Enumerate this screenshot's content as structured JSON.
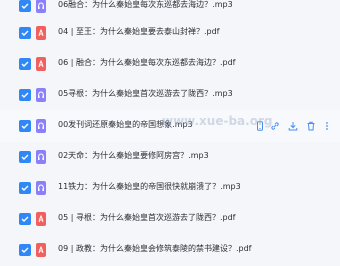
{
  "files": [
    {
      "name": "06融合：为什么秦始皇每次东巡都去海边？.mp3",
      "type": "mp3",
      "checked": true
    },
    {
      "name": "04 | 至王：为什么秦始皇要去泰山封禅？.pdf",
      "type": "pdf",
      "checked": true
    },
    {
      "name": "06 | 融合：为什么秦始皇每次东巡都去海边？.pdf",
      "type": "pdf",
      "checked": true
    },
    {
      "name": "05寻根：为什么秦始皇首次巡游去了陇西？.mp3",
      "type": "mp3",
      "checked": true
    },
    {
      "name": "00发刊词还原秦始皇的帝国想象.mp3",
      "type": "mp3",
      "checked": true
    },
    {
      "name": "02天命：为什么秦始皇要修阿房宫？.mp3",
      "type": "mp3",
      "checked": true
    },
    {
      "name": "11铁力：为什么秦始皇的帝国很快就崩溃了？.mp3",
      "type": "mp3",
      "checked": true
    },
    {
      "name": "05 | 寻根：为什么秦始皇首次巡游去了陇西？.pdf",
      "type": "pdf",
      "checked": true
    },
    {
      "name": "09 | 政教：为什么秦始皇会修筑泰陵的禁书建设？.pdf",
      "type": "pdf",
      "checked": true
    }
  ],
  "hovered_actions": [
    "phone-icon",
    "link-icon",
    "download-icon",
    "delete-icon",
    "more-icon"
  ],
  "watermark": "www.xue-ba.org",
  "colors": {
    "checkbox": "#2f88f5",
    "pdf": "#f0605f",
    "mp3": "#8b80f9",
    "action": "#4a8ef0"
  }
}
